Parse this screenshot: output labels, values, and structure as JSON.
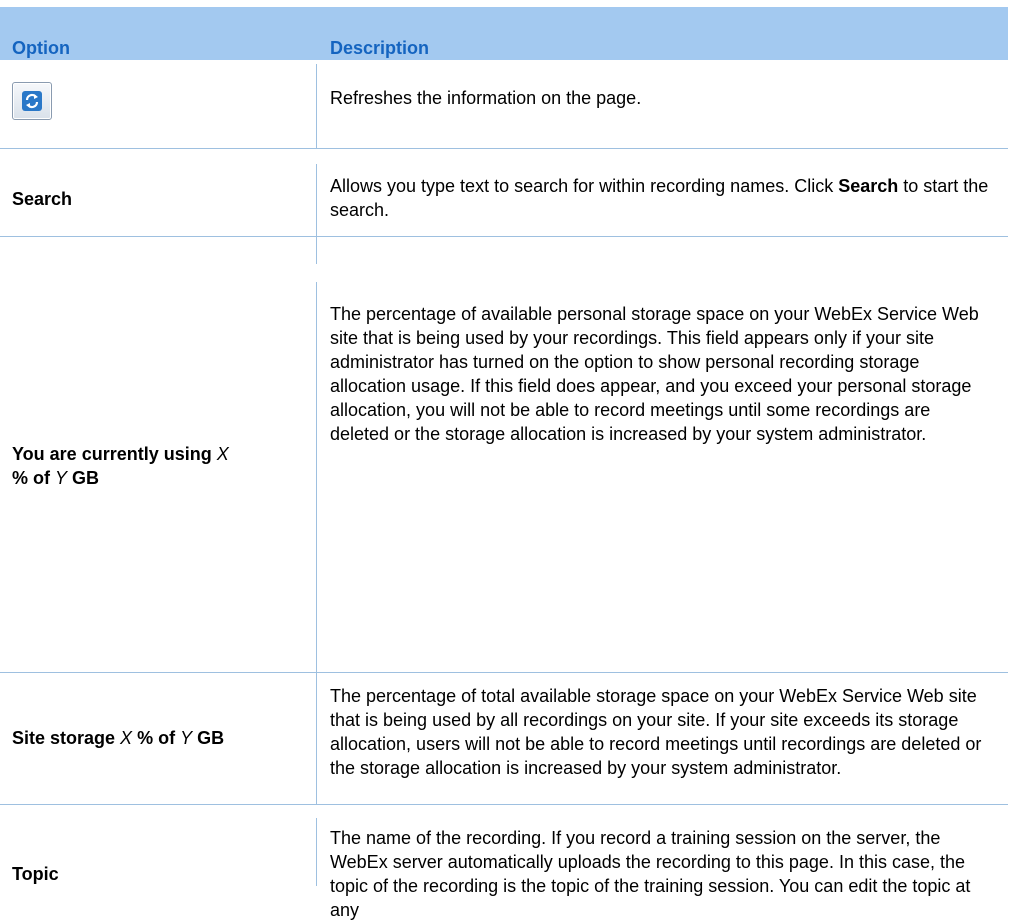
{
  "header": {
    "option_label": "Option",
    "description_label": "Description"
  },
  "rows": [
    {
      "option_icon": "refresh-icon",
      "description": "Refreshes the information on the page."
    },
    {
      "option": "Search",
      "description_parts": [
        "Allows you type text to search for within recording names. Click ",
        "Search",
        " to start the search."
      ]
    },
    {
      "option_parts": [
        "You are currently using ",
        "X",
        " % of ",
        "Y",
        " GB"
      ],
      "description": "The percentage of available personal storage space on your WebEx Service Web site that is being used by your recordings. This field appears only if your site administrator has turned on the option to show personal recording storage allocation usage. If this field does appear, and you exceed your personal storage allocation, you will not be able to record meetings until some recordings are deleted or the storage allocation is increased by your system administrator."
    },
    {
      "option_parts": [
        "Site storage ",
        "X",
        " % of ",
        "Y",
        " GB"
      ],
      "description": "The percentage of total available storage space on your WebEx Service Web site that is being used by all recordings on your site. If your site exceeds its storage allocation, users will not be able to record meetings until recordings are deleted or the storage allocation is increased by your system administrator."
    },
    {
      "option": "Topic",
      "description": "The name of the recording. If you record a training session on the server, the WebEx server automatically uploads the recording to this page. In this case, the topic of the recording is the topic of the training session. You can edit the topic at any"
    }
  ],
  "colors": {
    "header_bg": "#a3c9f0",
    "header_text": "#1464c0",
    "rule": "#9ec0e0",
    "icon_blue": "#2a78c8"
  }
}
